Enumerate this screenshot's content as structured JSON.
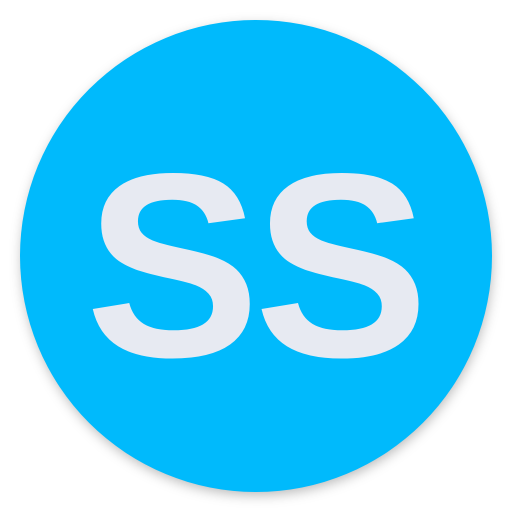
{
  "icon": {
    "monogram": "SS",
    "background_color": "#00BAFC",
    "text_color": "#E7EAF2",
    "shape": "circle"
  }
}
